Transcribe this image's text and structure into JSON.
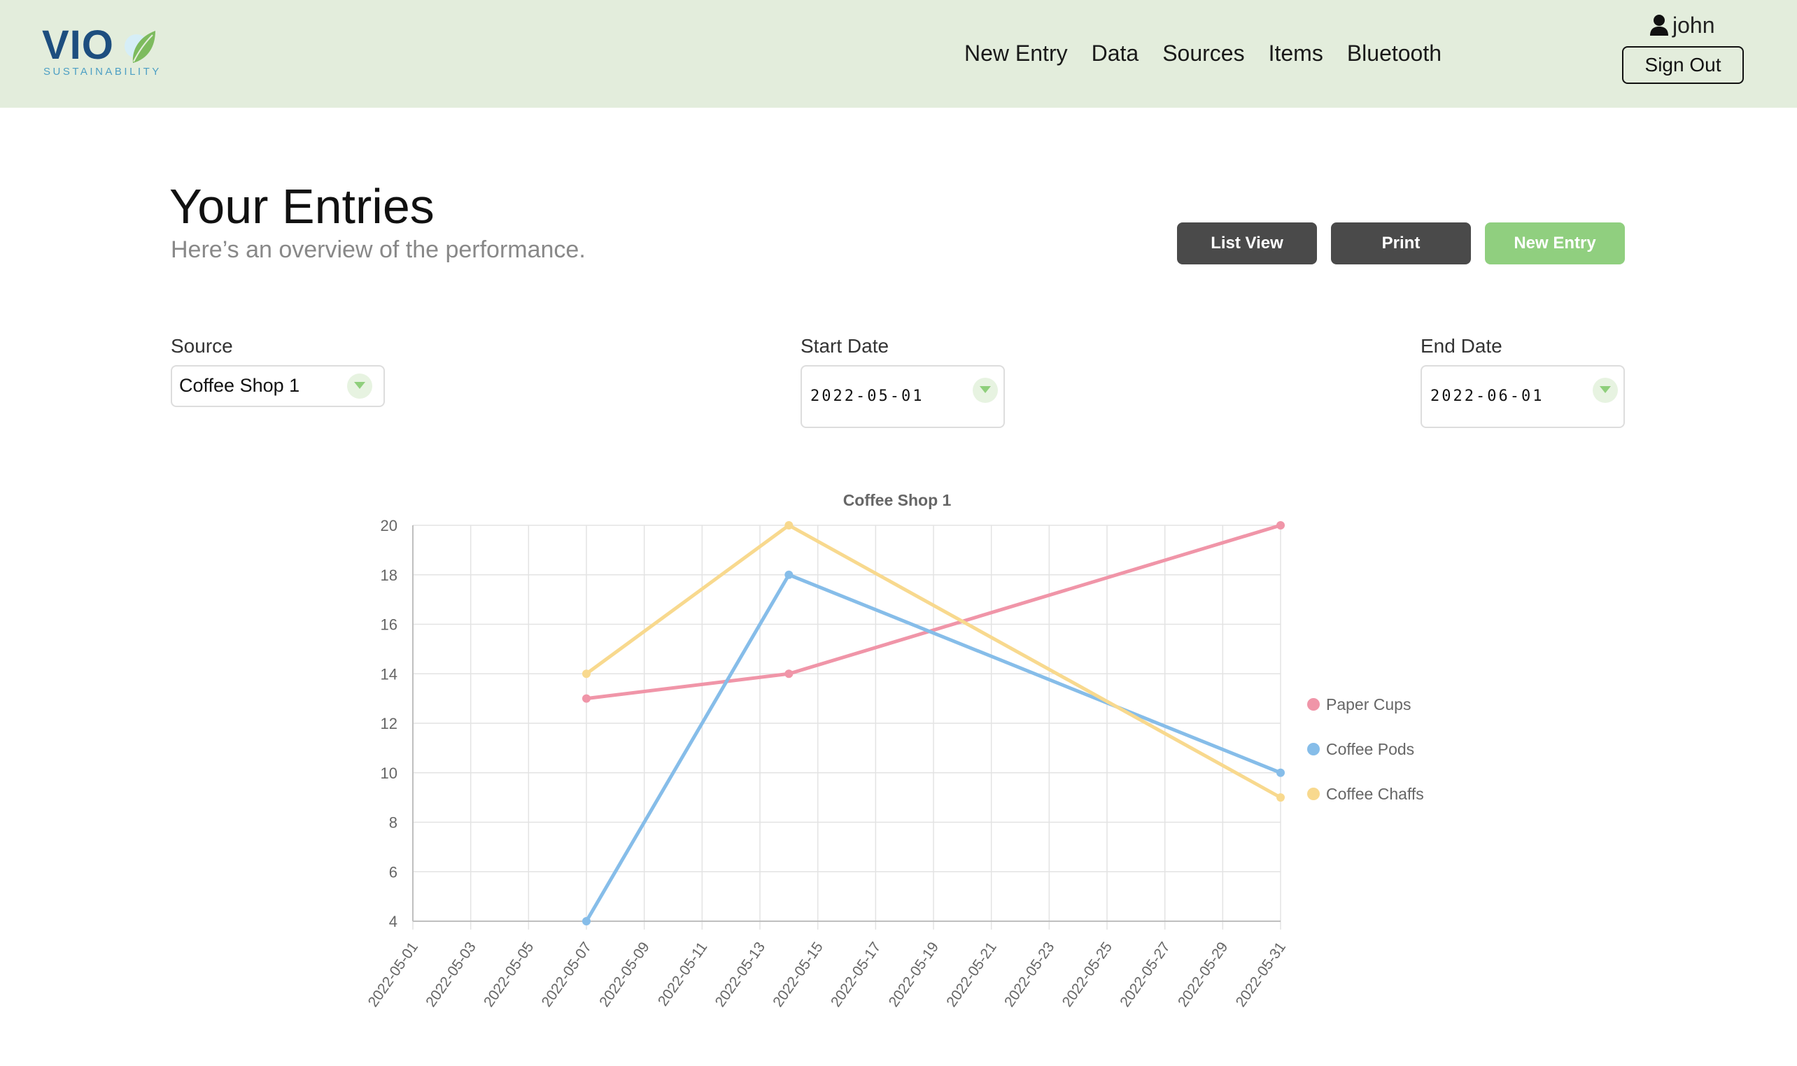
{
  "brand": {
    "name": "VIO",
    "tagline": "SUSTAINABILITY"
  },
  "nav": {
    "items": [
      {
        "label": "New Entry"
      },
      {
        "label": "Data"
      },
      {
        "label": "Sources"
      },
      {
        "label": "Items"
      },
      {
        "label": "Bluetooth"
      }
    ]
  },
  "user": {
    "name": "john",
    "icon": "person-icon",
    "signout_label": "Sign Out"
  },
  "page": {
    "title": "Your Entries",
    "subtitle": "Here’s an overview of the performance.",
    "buttons": {
      "list_view": "List View",
      "print": "Print",
      "new_entry": "New Entry"
    }
  },
  "filters": {
    "source": {
      "label": "Source",
      "value": "Coffee Shop 1"
    },
    "start_date": {
      "label": "Start Date",
      "value": "2022-05-01"
    },
    "end_date": {
      "label": "End Date",
      "value": "2022-06-01"
    }
  },
  "colors": {
    "header_bg": "#e3eddc",
    "accent_green": "#90cf7f",
    "dark_button": "#4a4a4a"
  },
  "chart_data": {
    "type": "line",
    "title": "Coffee Shop 1",
    "xlabel": "",
    "ylabel": "",
    "x_ticks": [
      "2022-05-01",
      "2022-05-03",
      "2022-05-05",
      "2022-05-07",
      "2022-05-09",
      "2022-05-11",
      "2022-05-13",
      "2022-05-15",
      "2022-05-17",
      "2022-05-19",
      "2022-05-21",
      "2022-05-23",
      "2022-05-25",
      "2022-05-27",
      "2022-05-29",
      "2022-05-31"
    ],
    "y_ticks": [
      4,
      6,
      8,
      10,
      12,
      14,
      16,
      18,
      20
    ],
    "xlim": [
      "2022-05-01",
      "2022-05-31"
    ],
    "ylim": [
      4,
      20
    ],
    "grid": true,
    "legend_position": "right",
    "series": [
      {
        "name": "Paper Cups",
        "color": "#f095a8",
        "points": [
          {
            "x": "2022-05-07",
            "y": 13
          },
          {
            "x": "2022-05-14",
            "y": 14
          },
          {
            "x": "2022-05-31",
            "y": 20
          }
        ]
      },
      {
        "name": "Coffee Pods",
        "color": "#86bde9",
        "points": [
          {
            "x": "2022-05-07",
            "y": 4
          },
          {
            "x": "2022-05-14",
            "y": 18
          },
          {
            "x": "2022-05-31",
            "y": 10
          }
        ]
      },
      {
        "name": "Coffee Chaffs",
        "color": "#f8d98e",
        "points": [
          {
            "x": "2022-05-07",
            "y": 14
          },
          {
            "x": "2022-05-14",
            "y": 20
          },
          {
            "x": "2022-05-31",
            "y": 9
          }
        ]
      }
    ]
  }
}
